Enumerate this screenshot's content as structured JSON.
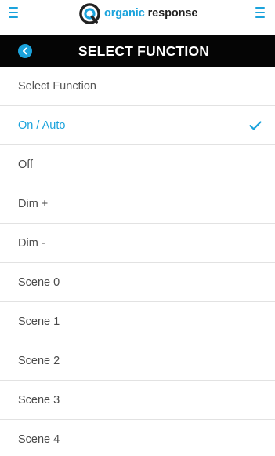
{
  "header": {
    "brand_part1": "organic",
    "brand_part2": "response",
    "logo_icon": "organic-response-logo-icon",
    "left_menu_icon": "hamburger-icon",
    "right_menu_icon": "hamburger-icon"
  },
  "titlebar": {
    "title": "SELECT FUNCTION",
    "back_icon": "chevron-left-icon"
  },
  "list": {
    "header_label": "Select Function",
    "options": [
      {
        "label": "On / Auto",
        "selected": true
      },
      {
        "label": "Off",
        "selected": false
      },
      {
        "label": "Dim +",
        "selected": false
      },
      {
        "label": "Dim -",
        "selected": false
      },
      {
        "label": "Scene 0",
        "selected": false
      },
      {
        "label": "Scene 1",
        "selected": false
      },
      {
        "label": "Scene 2",
        "selected": false
      },
      {
        "label": "Scene 3",
        "selected": false
      },
      {
        "label": "Scene 4",
        "selected": false
      }
    ]
  },
  "colors": {
    "accent": "#1ba3dc",
    "titlebar_bg": "#050505",
    "text": "#4a4a4a",
    "divider": "#e2e2e2",
    "brand_dark": "#222222"
  }
}
